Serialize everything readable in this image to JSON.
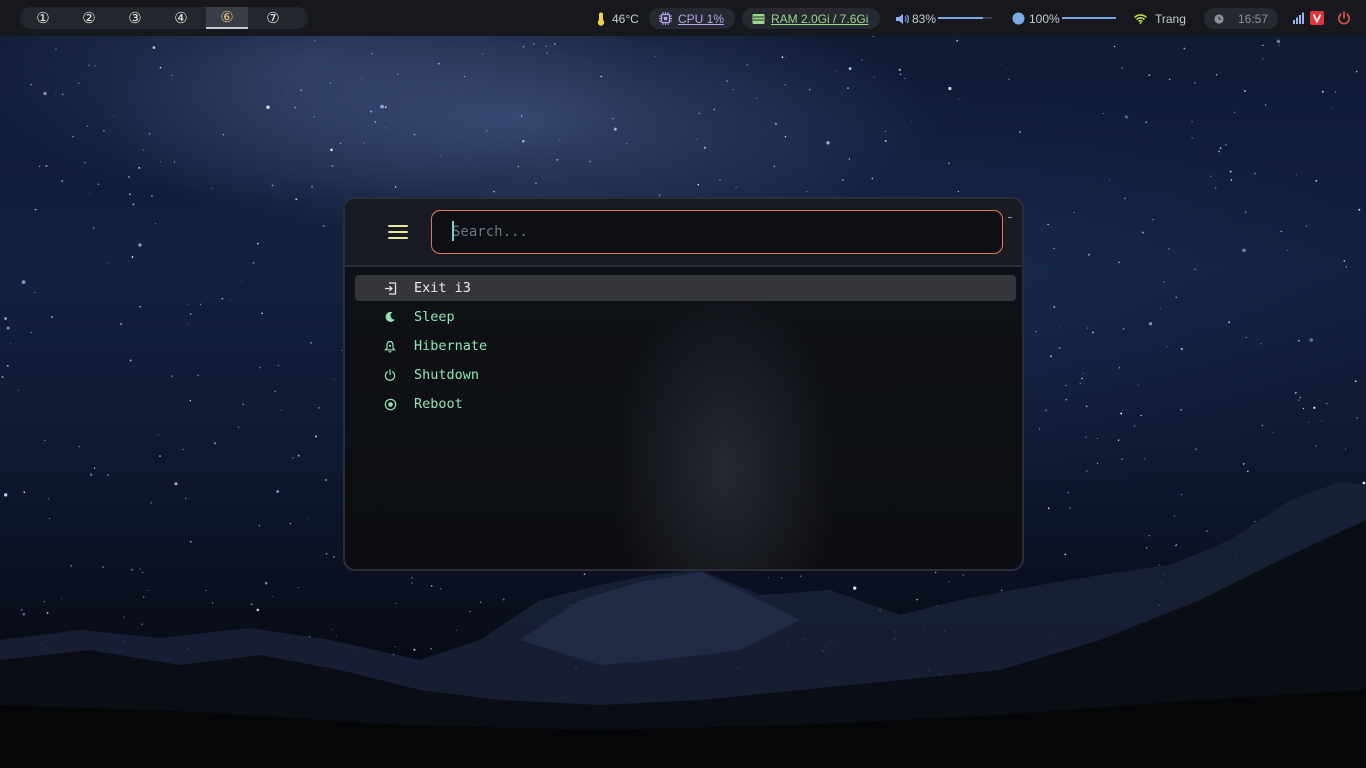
{
  "workspaces": [
    {
      "label": "①"
    },
    {
      "label": "②"
    },
    {
      "label": "③"
    },
    {
      "label": "④"
    },
    {
      "label": "⑥",
      "active": true
    },
    {
      "label": "⑦"
    }
  ],
  "status": {
    "temperature": "46°C",
    "cpu": "CPU 1%",
    "ram": "RAM 2.0Gi / 7.6Gi",
    "volume": "83%",
    "volume_level": 0.83,
    "brightness": "100%",
    "brightness_level": 1.0,
    "wifi": "Trang",
    "clock": "16:57"
  },
  "colors": {
    "accent_orange": "#e27a5a",
    "item_green": "#8fe6b3",
    "menu_icon_yellow": "#e9e6a0",
    "cpu_purple": "#b6a6f0",
    "ram_green": "#9bd78a",
    "power_red": "#e05050"
  },
  "launcher": {
    "search_placeholder": "Search...",
    "items": [
      {
        "label": "Exit i3",
        "icon": "exit-icon",
        "selected": true
      },
      {
        "label": "Sleep",
        "icon": "moon-icon"
      },
      {
        "label": "Hibernate",
        "icon": "bell-icon"
      },
      {
        "label": "Shutdown",
        "icon": "power-icon"
      },
      {
        "label": "Reboot",
        "icon": "reboot-icon"
      }
    ]
  }
}
